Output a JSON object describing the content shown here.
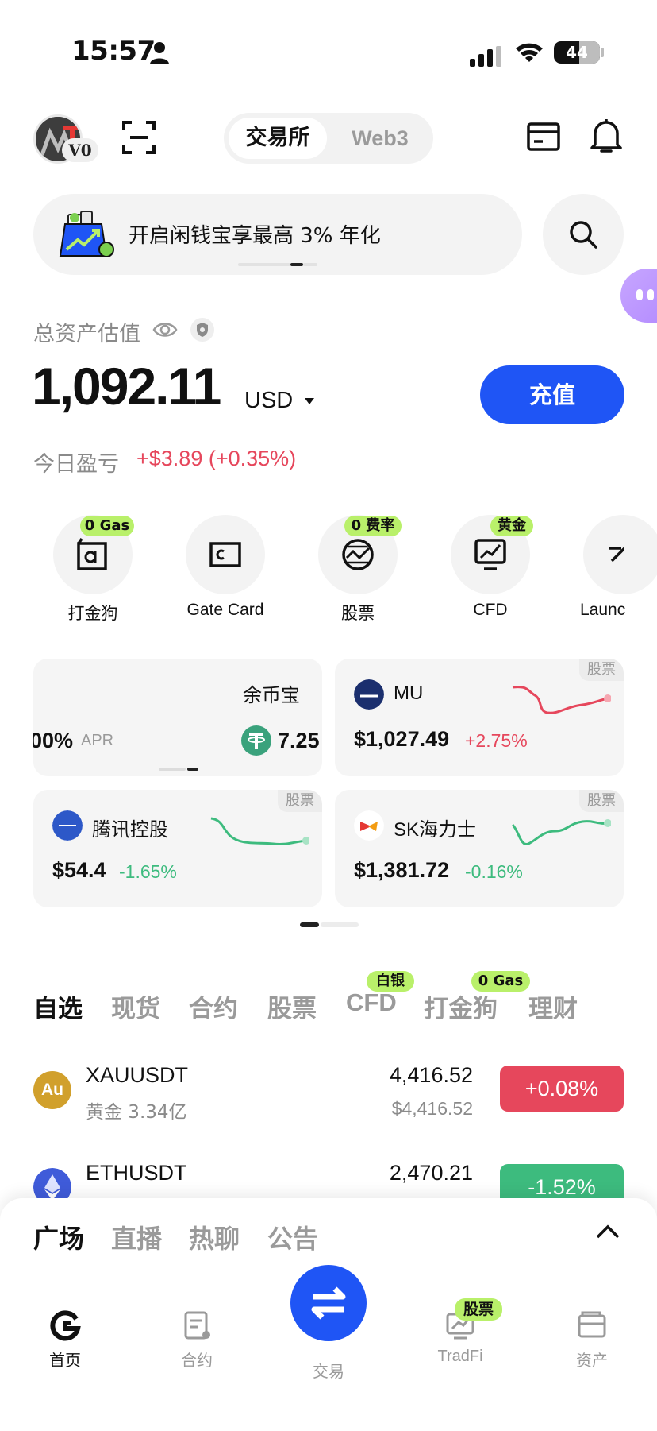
{
  "status_bar": {
    "time": "15:57",
    "battery": "44"
  },
  "header": {
    "avatar_level": "V0",
    "segment": {
      "active": "交易所",
      "inactive": "Web3"
    }
  },
  "banner": {
    "text": "开启闲钱宝享最高 3% 年化"
  },
  "assets": {
    "label": "总资产估值",
    "value": "1,092.11",
    "currency": "USD",
    "deposit_label": "充值",
    "pnl_label": "今日盈亏",
    "pnl_value": "+$3.89 (+0.35%)"
  },
  "shortcuts": [
    {
      "label": "打金狗",
      "badge": "0 Gas",
      "icon": "alpha-icon"
    },
    {
      "label": "Gate Card",
      "badge": "",
      "icon": "card-icon"
    },
    {
      "label": "股票",
      "badge": "0 费率",
      "icon": "globe-stock-icon"
    },
    {
      "label": "CFD",
      "badge": "黄金",
      "icon": "chart-monitor-icon"
    },
    {
      "label": "Launc",
      "badge": "",
      "icon": "launch-icon"
    }
  ],
  "tiles": {
    "yubibao": {
      "name": "余币宝",
      "apr_prefix": "00%",
      "apr_label": "APR",
      "rate": "7.25"
    },
    "mu": {
      "name": "MU",
      "price": "$1,027.49",
      "change": "+2.75%",
      "tag": "股票"
    },
    "tencent": {
      "name": "腾讯控股",
      "price": "$54.4",
      "change": "-1.65%",
      "tag": "股票"
    },
    "skhynix": {
      "name": "SK海力士",
      "price": "$1,381.72",
      "change": "-0.16%",
      "tag": "股票"
    }
  },
  "market_tabs": [
    {
      "label": "自选",
      "badge": ""
    },
    {
      "label": "现货",
      "badge": ""
    },
    {
      "label": "合约",
      "badge": ""
    },
    {
      "label": "股票",
      "badge": ""
    },
    {
      "label": "CFD",
      "badge": "白银"
    },
    {
      "label": "打金狗",
      "badge": "0 Gas"
    },
    {
      "label": "理财",
      "badge": ""
    }
  ],
  "rows": [
    {
      "symbol": "XAUUSDT",
      "sub": "黄金 3.34亿",
      "price": "4,416.52",
      "price_usd": "$4,416.52",
      "change": "+0.08%",
      "logo": "Au"
    },
    {
      "symbol": "ETHUSDT",
      "sub": "",
      "price": "2,470.21",
      "price_usd": "",
      "change": "-1.52%",
      "logo": ""
    }
  ],
  "feed_tabs": [
    "广场",
    "直播",
    "热聊",
    "公告"
  ],
  "bottom_nav": [
    {
      "label": "首页",
      "badge": ""
    },
    {
      "label": "合约",
      "badge": ""
    },
    {
      "label": "交易",
      "badge": ""
    },
    {
      "label": "TradFi",
      "badge": "股票"
    },
    {
      "label": "资产",
      "badge": ""
    }
  ],
  "colors": {
    "brand_blue": "#1f55f5",
    "up_red": "#e6475c",
    "down_green": "#3dbb7e",
    "badge_green": "#b9f06a"
  }
}
